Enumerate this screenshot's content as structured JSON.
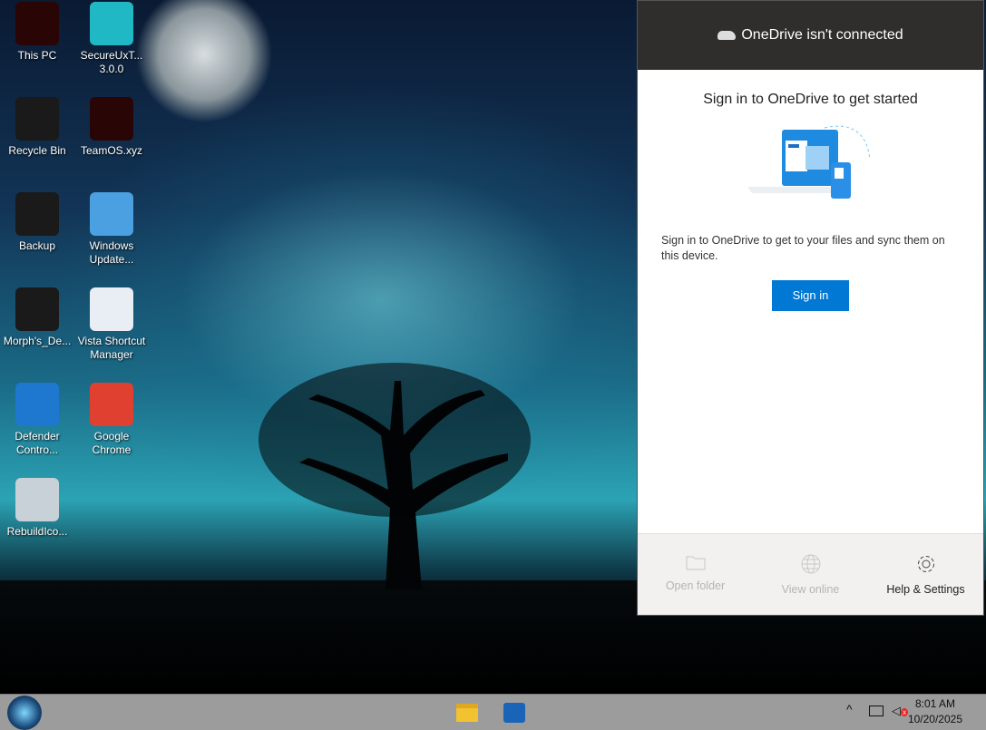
{
  "desktop": {
    "icons": [
      {
        "label": "This PC",
        "color": "#2a0505"
      },
      {
        "label": "SecureUxT... 3.0.0",
        "color": "#20b8c4"
      },
      {
        "label": "Recycle Bin",
        "color": "#1a1a1a"
      },
      {
        "label": "TeamOS.xyz",
        "color": "#2a0505"
      },
      {
        "label": "Backup",
        "color": "#1a1a1a"
      },
      {
        "label": "Windows Update...",
        "color": "#4aa0e0"
      },
      {
        "label": "Morph's_De...",
        "color": "#1a1a1a"
      },
      {
        "label": "Vista Shortcut Manager",
        "color": "#e8eef4"
      },
      {
        "label": "Defender Contro...",
        "color": "#1e78d0"
      },
      {
        "label": "Google Chrome",
        "color": "#e04030"
      },
      {
        "label": "RebuildIco...",
        "color": "#c8d0d8"
      }
    ]
  },
  "onedrive": {
    "header": "OneDrive isn't connected",
    "title": "Sign in to OneDrive to get started",
    "description": "Sign in to OneDrive to get to your files and sync them on this device.",
    "signin": "Sign in",
    "footer": [
      "Open folder",
      "View online",
      "Help & Settings"
    ]
  },
  "taskbar": {
    "time": "8:01 AM",
    "date": "10/20/2025"
  }
}
